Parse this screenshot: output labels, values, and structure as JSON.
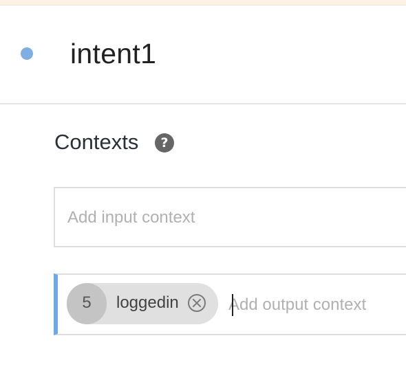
{
  "intent": {
    "name": "intent1",
    "status_color": "#7eaee2"
  },
  "contexts": {
    "title": "Contexts",
    "help_icon": "question-circle-icon",
    "input": {
      "placeholder": "Add input context",
      "value": ""
    },
    "output": {
      "placeholder": "Add output context",
      "value": "",
      "accent_color": "#6fa8e6",
      "chips": [
        {
          "lifespan": "5",
          "name": "loggedin",
          "remove_icon": "close-circle-icon"
        }
      ]
    }
  }
}
